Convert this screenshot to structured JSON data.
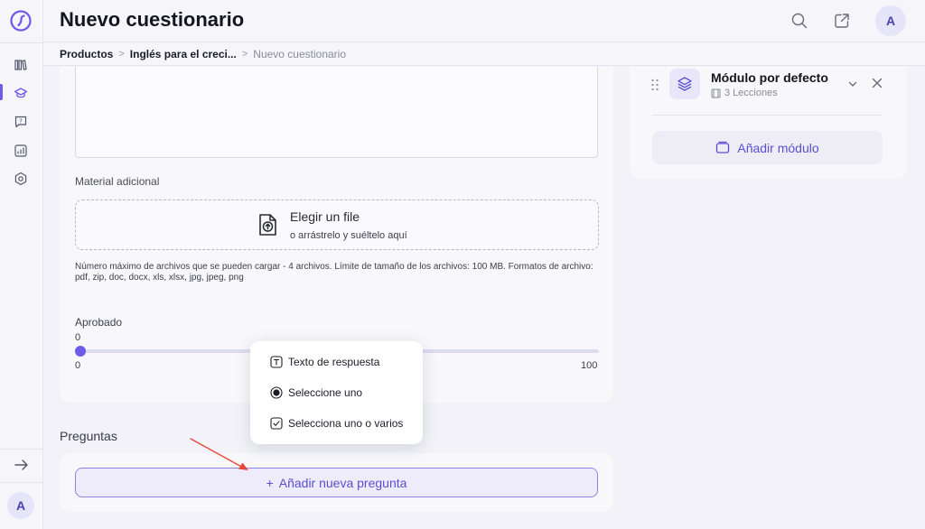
{
  "header": {
    "title": "Nuevo cuestionario",
    "avatar_initial": "A"
  },
  "sidebar": {
    "avatar_initial": "A",
    "items": [
      {
        "icon": "library-icon"
      },
      {
        "icon": "graduation-cap-icon",
        "active": true
      },
      {
        "icon": "chat-question-icon"
      },
      {
        "icon": "analytics-icon"
      },
      {
        "icon": "settings-hexagon-icon"
      }
    ]
  },
  "breadcrumb": {
    "items": [
      "Productos",
      "Inglés para el creci...",
      "Nuevo cuestionario"
    ],
    "separator": ">"
  },
  "form": {
    "material_label": "Material adicional",
    "upload": {
      "title": "Elegir un file",
      "subtitle": "o arrástrelo y suéltelo aquí"
    },
    "file_note": "Número máximo de archivos que se pueden cargar - 4 archivos. Límite de tamaño de los archivos: 100 MB. Formatos de archivo: pdf, zip, doc, docx, xls, xlsx, jpg, jpeg, png",
    "aprobado": {
      "label": "Aprobado",
      "value": "0",
      "min": "0",
      "max": "100"
    }
  },
  "questions": {
    "title": "Preguntas",
    "add_button": "Añadir nueva pregunta",
    "add_button_prefix": "+"
  },
  "question_type_menu": {
    "items": [
      {
        "label": "Texto de respuesta",
        "icon": "text-box-icon"
      },
      {
        "label": "Seleccione uno",
        "icon": "radio-selected-icon"
      },
      {
        "label": "Selecciona uno o varios",
        "icon": "checkbox-checked-icon"
      }
    ]
  },
  "modules": {
    "module": {
      "title": "Módulo por defecto",
      "lessons": "3 Lecciones"
    },
    "add_button": "Añadir módulo"
  },
  "colors": {
    "accent": "#6c5ce7",
    "annotation_arrow": "#e5483a"
  }
}
